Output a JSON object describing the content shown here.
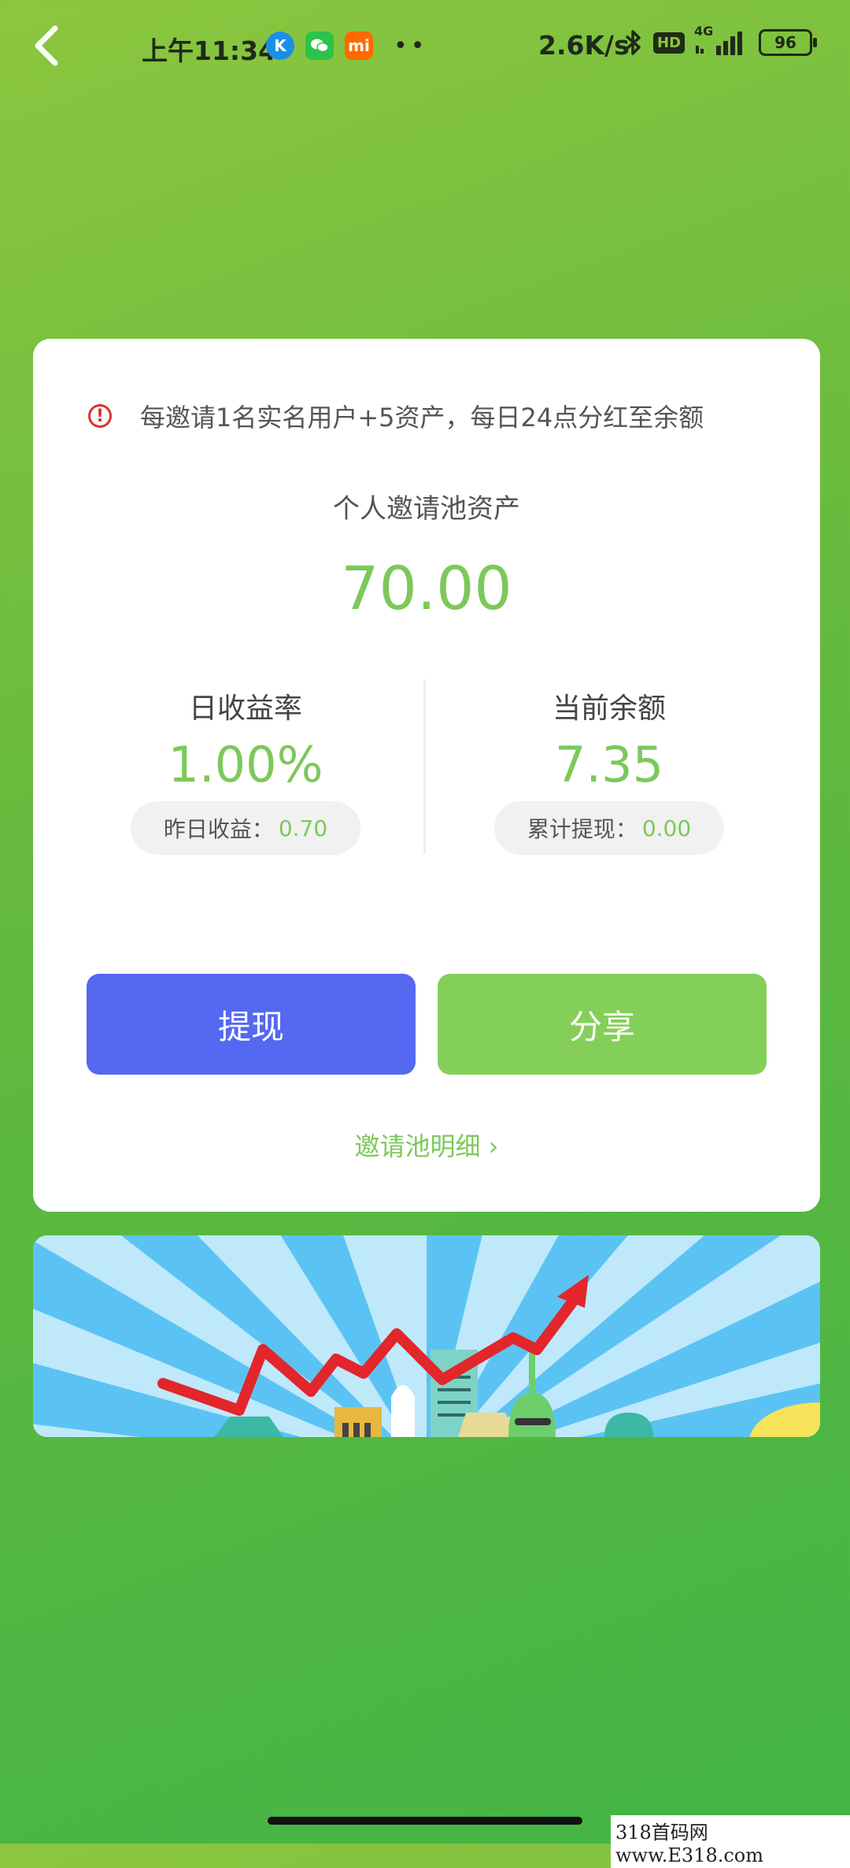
{
  "status_bar": {
    "time": "上午11:34",
    "net_speed": "2.6K/s",
    "hd": "HD",
    "signal_type": "4G",
    "battery": "96",
    "icons": [
      "kugou-icon",
      "wechat-icon",
      "mi-icon"
    ]
  },
  "card": {
    "notice": "每邀请1名实名用户+5资产，每日24点分红至余额",
    "pool_label": "个人邀请池资产",
    "pool_amount": "70.00",
    "left_stat": {
      "label": "日收益率",
      "value": "1.00%",
      "pill_label": "昨日收益：",
      "pill_value": "0.70"
    },
    "right_stat": {
      "label": "当前余额",
      "value": "7.35",
      "pill_label": "累计提现：",
      "pill_value": "0.00"
    },
    "withdraw_button": "提现",
    "share_button": "分享",
    "detail_link": "邀请池明细 ›"
  },
  "watermark": "318首码网 www.E318.com",
  "colors": {
    "accent_green": "#7dc85a",
    "withdraw_blue": "#5468f1",
    "share_green": "#84cf59",
    "alert_red": "#d9342b"
  }
}
